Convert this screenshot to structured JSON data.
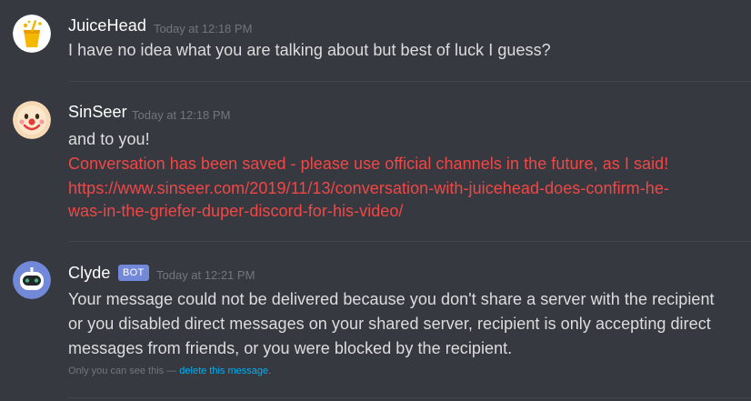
{
  "messages": [
    {
      "username": "JuiceHead",
      "timestamp": "Today at 12:18 PM",
      "lines": [
        "I have no idea what you are talking about but best of luck I guess?"
      ]
    },
    {
      "username": "SinSeer",
      "timestamp": "Today at 12:18 PM",
      "lines": [
        "and to you!",
        "Conversation has been saved - please use official channels in the future, as I said!",
        "https://www.sinseer.com/2019/11/13/conversation-with-juicehead-does-confirm-he-",
        "was-in-the-griefer-duper-discord-for-his-video/"
      ]
    },
    {
      "username": "Clyde",
      "badge": "BOT",
      "timestamp": "Today at 12:21 PM",
      "lines": [
        "Your message could not be delivered because you don't share a server with the recipient",
        "or you disabled direct messages on your shared server, recipient is only accepting direct",
        "messages from friends, or you were blocked by the recipient."
      ],
      "note": {
        "prefix": "Only you can see this — ",
        "link": "delete this message",
        "suffix": "."
      }
    }
  ],
  "colors": {
    "background": "#36393f",
    "username": "#ffffff",
    "timestamp": "#72767d",
    "text": "#dcddde",
    "warning_text": "#f04747",
    "bot_badge": "#7289da",
    "link": "#00b0f4"
  },
  "avatars": [
    "juice-cup-icon",
    "clown-face-icon",
    "clyde-robot-icon"
  ]
}
